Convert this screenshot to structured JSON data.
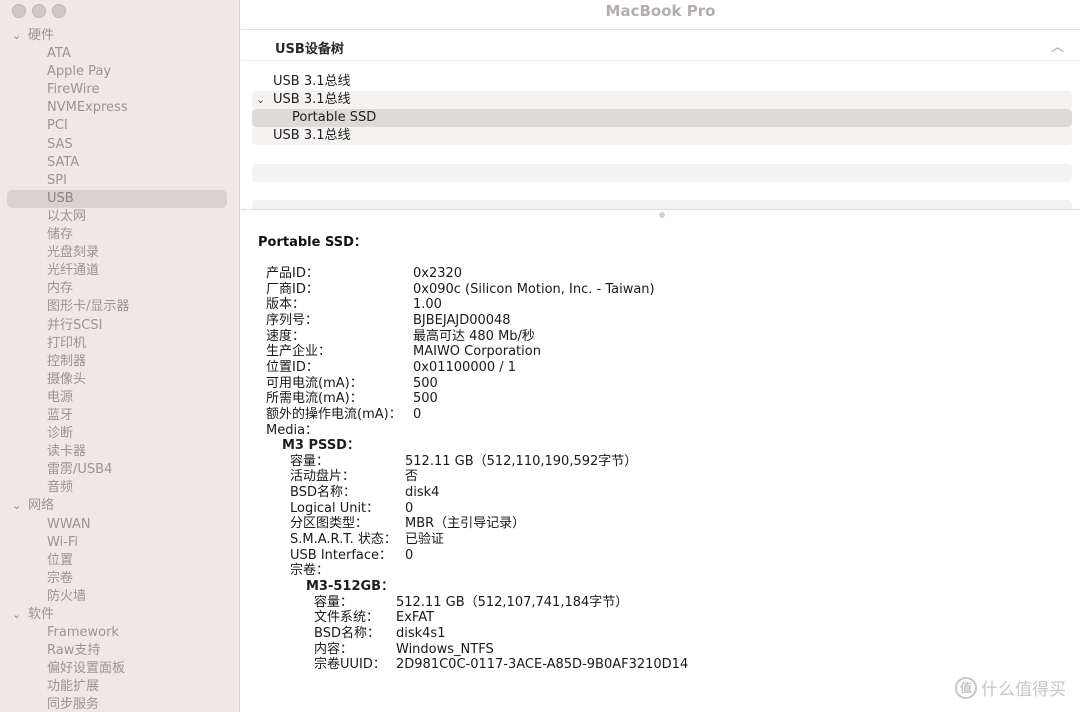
{
  "window": {
    "title": "MacBook Pro"
  },
  "sidebar": {
    "rows": [
      {
        "type": "cat",
        "label": "硬件"
      },
      {
        "type": "item",
        "label": "ATA"
      },
      {
        "type": "item",
        "label": "Apple Pay"
      },
      {
        "type": "item",
        "label": "FireWire"
      },
      {
        "type": "item",
        "label": "NVMExpress"
      },
      {
        "type": "item",
        "label": "PCI"
      },
      {
        "type": "item",
        "label": "SAS"
      },
      {
        "type": "item",
        "label": "SATA"
      },
      {
        "type": "item",
        "label": "SPI"
      },
      {
        "type": "item",
        "label": "USB",
        "selected": true
      },
      {
        "type": "item",
        "label": "以太网"
      },
      {
        "type": "item",
        "label": "储存"
      },
      {
        "type": "item",
        "label": "光盘刻录"
      },
      {
        "type": "item",
        "label": "光纤通道"
      },
      {
        "type": "item",
        "label": "内存"
      },
      {
        "type": "item",
        "label": "图形卡/显示器"
      },
      {
        "type": "item",
        "label": "并行SCSI"
      },
      {
        "type": "item",
        "label": "打印机"
      },
      {
        "type": "item",
        "label": "控制器"
      },
      {
        "type": "item",
        "label": "摄像头"
      },
      {
        "type": "item",
        "label": "电源"
      },
      {
        "type": "item",
        "label": "蓝牙"
      },
      {
        "type": "item",
        "label": "诊断"
      },
      {
        "type": "item",
        "label": "读卡器"
      },
      {
        "type": "item",
        "label": "雷雳/USB4"
      },
      {
        "type": "item",
        "label": "音频"
      },
      {
        "type": "cat",
        "label": "网络"
      },
      {
        "type": "item",
        "label": "WWAN"
      },
      {
        "type": "item",
        "label": "Wi-Fi"
      },
      {
        "type": "item",
        "label": "位置"
      },
      {
        "type": "item",
        "label": "宗卷"
      },
      {
        "type": "item",
        "label": "防火墙"
      },
      {
        "type": "cat",
        "label": "软件"
      },
      {
        "type": "item",
        "label": "Framework"
      },
      {
        "type": "item",
        "label": "Raw支持"
      },
      {
        "type": "item",
        "label": "偏好设置面板"
      },
      {
        "type": "item",
        "label": "功能扩展"
      },
      {
        "type": "item",
        "label": "同步服务"
      }
    ]
  },
  "tree": {
    "header": "USB设备树",
    "rows": [
      {
        "label": "USB 3.1总线",
        "level": 0,
        "expanded": false
      },
      {
        "label": "USB 3.1总线",
        "level": 0,
        "expanded": true
      },
      {
        "label": "Portable SSD",
        "level": 1,
        "selected": true
      },
      {
        "label": "USB 3.1总线",
        "level": 0,
        "expanded": false
      }
    ]
  },
  "detail": {
    "title": "Portable SSD：",
    "device": [
      {
        "k": "产品ID：",
        "v": "0x2320"
      },
      {
        "k": "厂商ID：",
        "v": "0x090c  (Silicon Motion, Inc. - Taiwan)"
      },
      {
        "k": "版本：",
        "v": "1.00"
      },
      {
        "k": "序列号：",
        "v": "BJBEJAJD00048"
      },
      {
        "k": "速度：",
        "v": "最高可达 480 Mb/秒"
      },
      {
        "k": "生产企业：",
        "v": "MAIWO Corporation"
      },
      {
        "k": "位置ID：",
        "v": "0x01100000 / 1"
      },
      {
        "k": "可用电流(mA)：",
        "v": "500"
      },
      {
        "k": "所需电流(mA)：",
        "v": "500"
      },
      {
        "k": "额外的操作电流(mA)：",
        "v": "0"
      },
      {
        "k": "Media：",
        "v": ""
      }
    ],
    "media_title": "M3 PSSD：",
    "media": [
      {
        "k": "容量：",
        "v": "512.11 GB（512,110,190,592字节）"
      },
      {
        "k": "活动盘片：",
        "v": "否"
      },
      {
        "k": "BSD名称：",
        "v": "disk4"
      },
      {
        "k": "Logical Unit：",
        "v": "0"
      },
      {
        "k": "分区图类型：",
        "v": "MBR（主引导记录）"
      },
      {
        "k": "S.M.A.R.T. 状态：",
        "v": "已验证"
      },
      {
        "k": "USB Interface：",
        "v": "0"
      },
      {
        "k": "宗卷：",
        "v": ""
      }
    ],
    "volume_title": "M3-512GB：",
    "volume": [
      {
        "k": "容量：",
        "v": "512.11 GB（512,107,741,184字节）"
      },
      {
        "k": "文件系统：",
        "v": "ExFAT"
      },
      {
        "k": "BSD名称：",
        "v": "disk4s1"
      },
      {
        "k": "内容：",
        "v": "Windows_NTFS"
      },
      {
        "k": "宗卷UUID：",
        "v": "2D981C0C-0117-3ACE-A85D-9B0AF3210D14"
      }
    ]
  },
  "watermark": {
    "logo": "值",
    "text": "什么值得买"
  },
  "icons": {
    "collapse": "chevron-up-icon",
    "expand": "chevron-down-icon",
    "expanded": "chevron-down-icon"
  }
}
